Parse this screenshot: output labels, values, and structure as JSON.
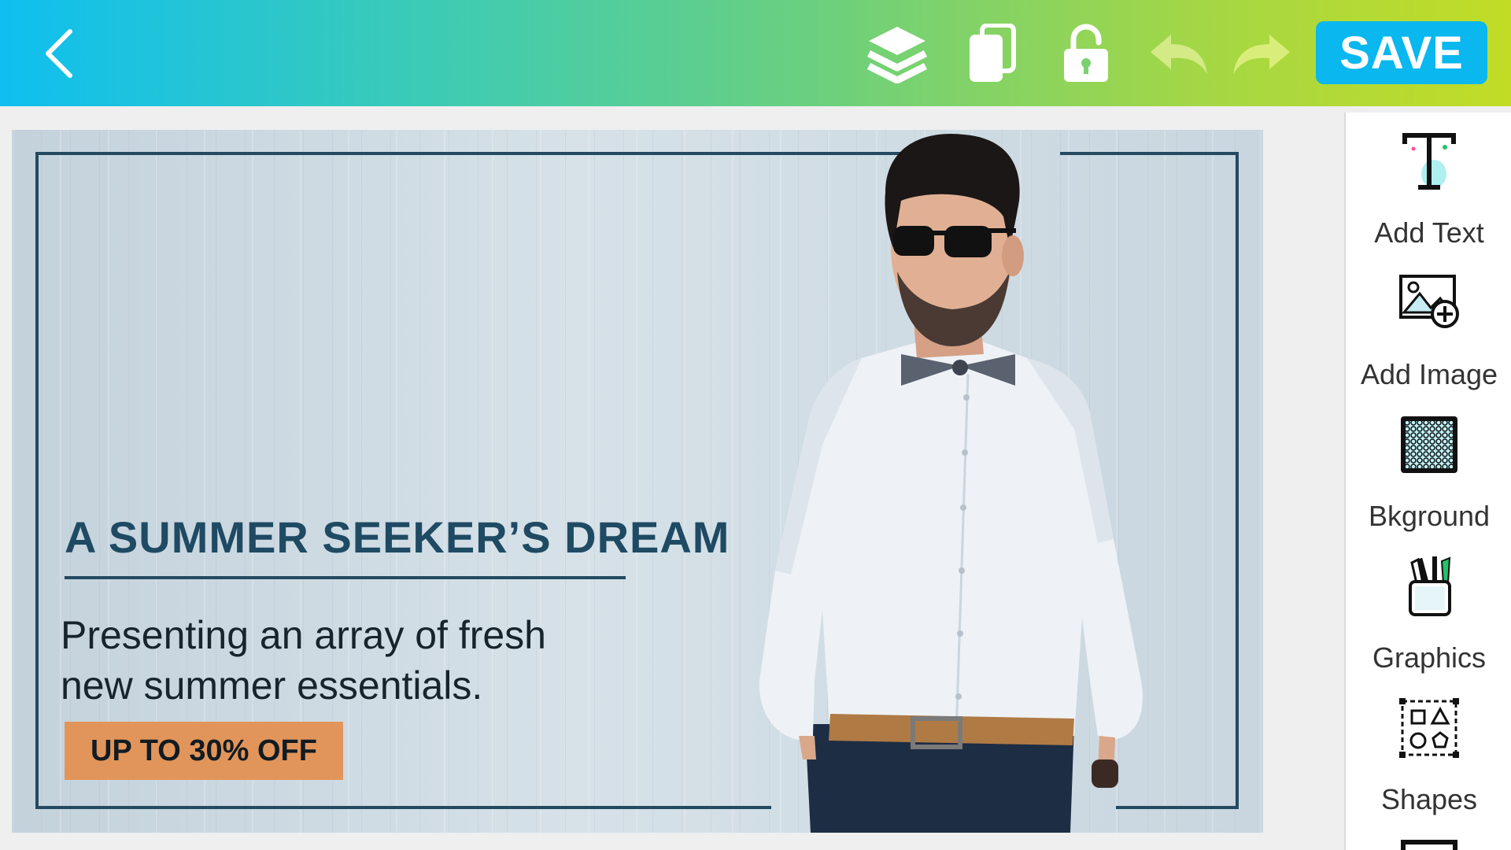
{
  "toolbar": {
    "back_icon": "chevron-left-icon",
    "layers_icon": "layers-icon",
    "duplicate_icon": "copy-icon",
    "lock_icon": "unlock-icon",
    "undo_icon": "undo-icon",
    "redo_icon": "redo-icon",
    "save_label": "SAVE",
    "colors": {
      "gradient_start": "#0fbff0",
      "gradient_end": "#c2dc26",
      "save_bg": "#0ab7ef"
    }
  },
  "design": {
    "headline": "A SUMMER SEEKER’S DREAM",
    "subtext_line1": "Presenting an array of fresh",
    "subtext_line2": "new summer essentials.",
    "promo": "UP TO 30% OFF",
    "colors": {
      "frame": "#234a60",
      "headline": "#1f4a63",
      "promo_bg": "#e2955a"
    }
  },
  "side_panel": {
    "items": [
      {
        "label": "Add Text",
        "icon": "text-icon"
      },
      {
        "label": "Add Image",
        "icon": "add-image-icon"
      },
      {
        "label": "Bkground",
        "icon": "background-pattern-icon"
      },
      {
        "label": "Graphics",
        "icon": "graphics-icon"
      },
      {
        "label": "Shapes",
        "icon": "shapes-icon"
      }
    ]
  }
}
